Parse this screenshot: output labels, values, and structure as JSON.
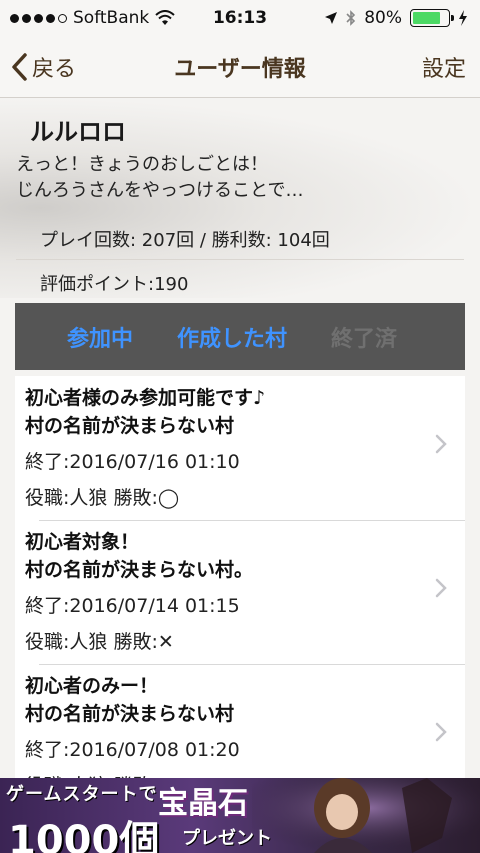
{
  "status_bar": {
    "carrier": "SoftBank",
    "time": "16:13",
    "battery_percent": "80%",
    "battery_level": 0.8,
    "signal_bars": 4
  },
  "nav": {
    "back_label": "戻る",
    "title": "ユーザー情報",
    "settings_label": "設定"
  },
  "profile": {
    "username": "ルルロロ",
    "message_line1": "えっと！きょうのおしごとは！",
    "message_line2": "じんろうさんをやっつけることで…",
    "stats": "プレイ回数: 207回 / 勝利数: 104回",
    "points": "評価ポイント:190"
  },
  "tabs": [
    {
      "label": "参加中",
      "state": "active"
    },
    {
      "label": "作成した村",
      "state": "active"
    },
    {
      "label": "終了済",
      "state": "disabled"
    }
  ],
  "villages": [
    {
      "title1": "初心者様のみ参加可能です♪",
      "title2": "村の名前が決まらない村",
      "ended": "終了:2016/07/16 01:10",
      "role": "役職:人狼 勝敗:◯"
    },
    {
      "title1": "初心者対象！",
      "title2": "村の名前が決まらない村。",
      "ended": "終了:2016/07/14 01:15",
      "role": "役職:人狼 勝敗:✕"
    },
    {
      "title1": "初心者のみー！",
      "title2": "村の名前が決まらない村",
      "ended": "終了:2016/07/08 01:20",
      "role": "役職:人狼 勝敗:"
    }
  ],
  "banner": {
    "line1": "ゲームスタートで",
    "gem": "宝晶石",
    "count": "1000個",
    "present": "プレゼント"
  },
  "colors": {
    "accent": "#4a3620",
    "tab_active": "#3f93ff",
    "tab_disabled": "#707070",
    "battery": "#4cd964"
  },
  "icons": {
    "back": "chevron-left-icon",
    "row": "chevron-right-icon",
    "wifi": "wifi-icon",
    "bluetooth": "bluetooth-icon",
    "location": "location-arrow-icon"
  }
}
